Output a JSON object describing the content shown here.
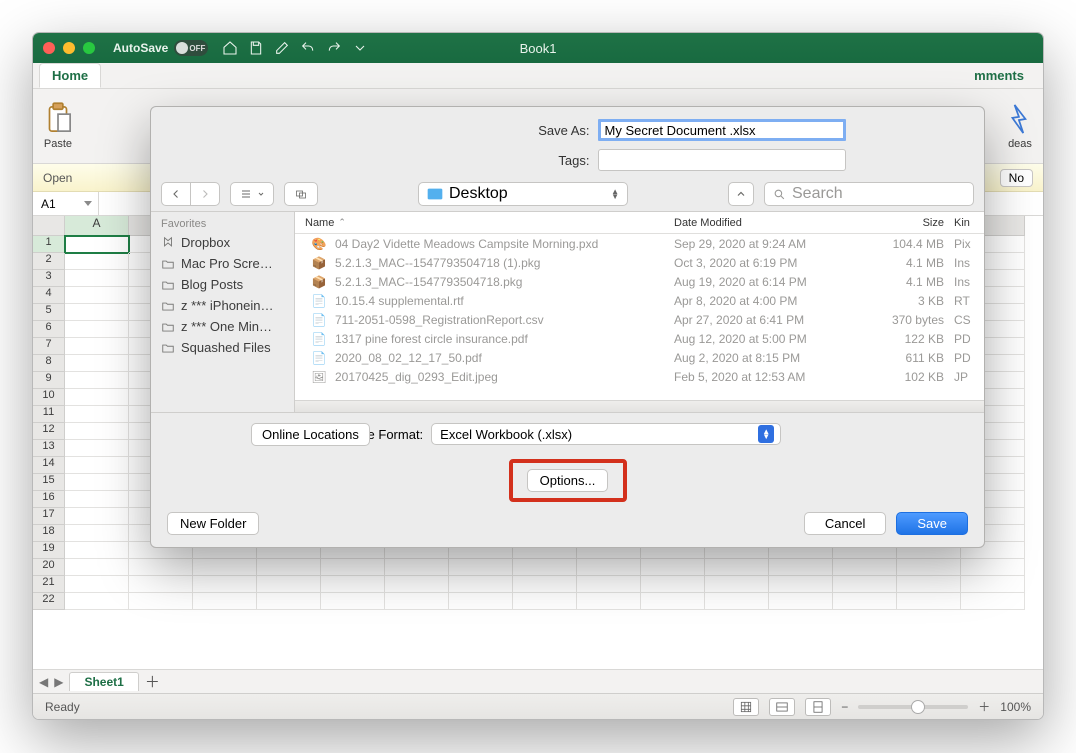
{
  "titlebar": {
    "autosave_label": "AutoSave",
    "autosave_state": "OFF",
    "title": "Book1"
  },
  "ribbon": {
    "home_tab": "Home",
    "comments": "mments",
    "paste": "Paste",
    "ideas": "deas"
  },
  "strip": {
    "open": "Open",
    "no": "No"
  },
  "namebox": "A1",
  "columns": [
    "A"
  ],
  "sheet_tab": "Sheet1",
  "status": {
    "ready": "Ready",
    "zoom": "100%"
  },
  "dialog": {
    "save_as_label": "Save As:",
    "save_as_value": "My Secret Document .xlsx",
    "tags_label": "Tags:",
    "location": "Desktop",
    "search_placeholder": "Search",
    "cols": {
      "name": "Name",
      "date": "Date Modified",
      "size": "Size",
      "kind": "Kin"
    },
    "sidebar_header": "Favorites",
    "sidebar": [
      "Dropbox",
      "Mac Pro Scre…",
      "Blog Posts",
      "z *** iPhonein…",
      "z *** One Min…",
      "Squashed Files"
    ],
    "files": [
      {
        "i": "pxd",
        "n": "04 Day2 Vidette Meadows Campsite Morning.pxd",
        "d": "Sep 29, 2020 at 9:24 AM",
        "s": "104.4 MB",
        "k": "Pix"
      },
      {
        "i": "pkg",
        "n": "5.2.1.3_MAC--1547793504718 (1).pkg",
        "d": "Oct 3, 2020 at 6:19 PM",
        "s": "4.1 MB",
        "k": "Ins"
      },
      {
        "i": "pkg",
        "n": "5.2.1.3_MAC--1547793504718.pkg",
        "d": "Aug 19, 2020 at 6:14 PM",
        "s": "4.1 MB",
        "k": "Ins"
      },
      {
        "i": "rtf",
        "n": "10.15.4 supplemental.rtf",
        "d": "Apr 8, 2020 at 4:00 PM",
        "s": "3 KB",
        "k": "RT"
      },
      {
        "i": "csv",
        "n": "711-2051-0598_RegistrationReport.csv",
        "d": "Apr 27, 2020 at 6:41 PM",
        "s": "370 bytes",
        "k": "CS"
      },
      {
        "i": "pdf",
        "n": "1317 pine forest circle insurance.pdf",
        "d": "Aug 12, 2020 at 5:00 PM",
        "s": "122 KB",
        "k": "PD"
      },
      {
        "i": "pdf",
        "n": "2020_08_02_12_17_50.pdf",
        "d": "Aug 2, 2020 at 8:15 PM",
        "s": "611 KB",
        "k": "PD"
      },
      {
        "i": "jpg",
        "n": "20170425_dig_0293_Edit.jpeg",
        "d": "Feb 5, 2020 at 12:53 AM",
        "s": "102 KB",
        "k": "JP"
      }
    ],
    "online_locations": "Online Locations",
    "file_format_label": "File Format:",
    "file_format_value": "Excel Workbook (.xlsx)",
    "options": "Options...",
    "new_folder": "New Folder",
    "cancel": "Cancel",
    "save": "Save"
  }
}
